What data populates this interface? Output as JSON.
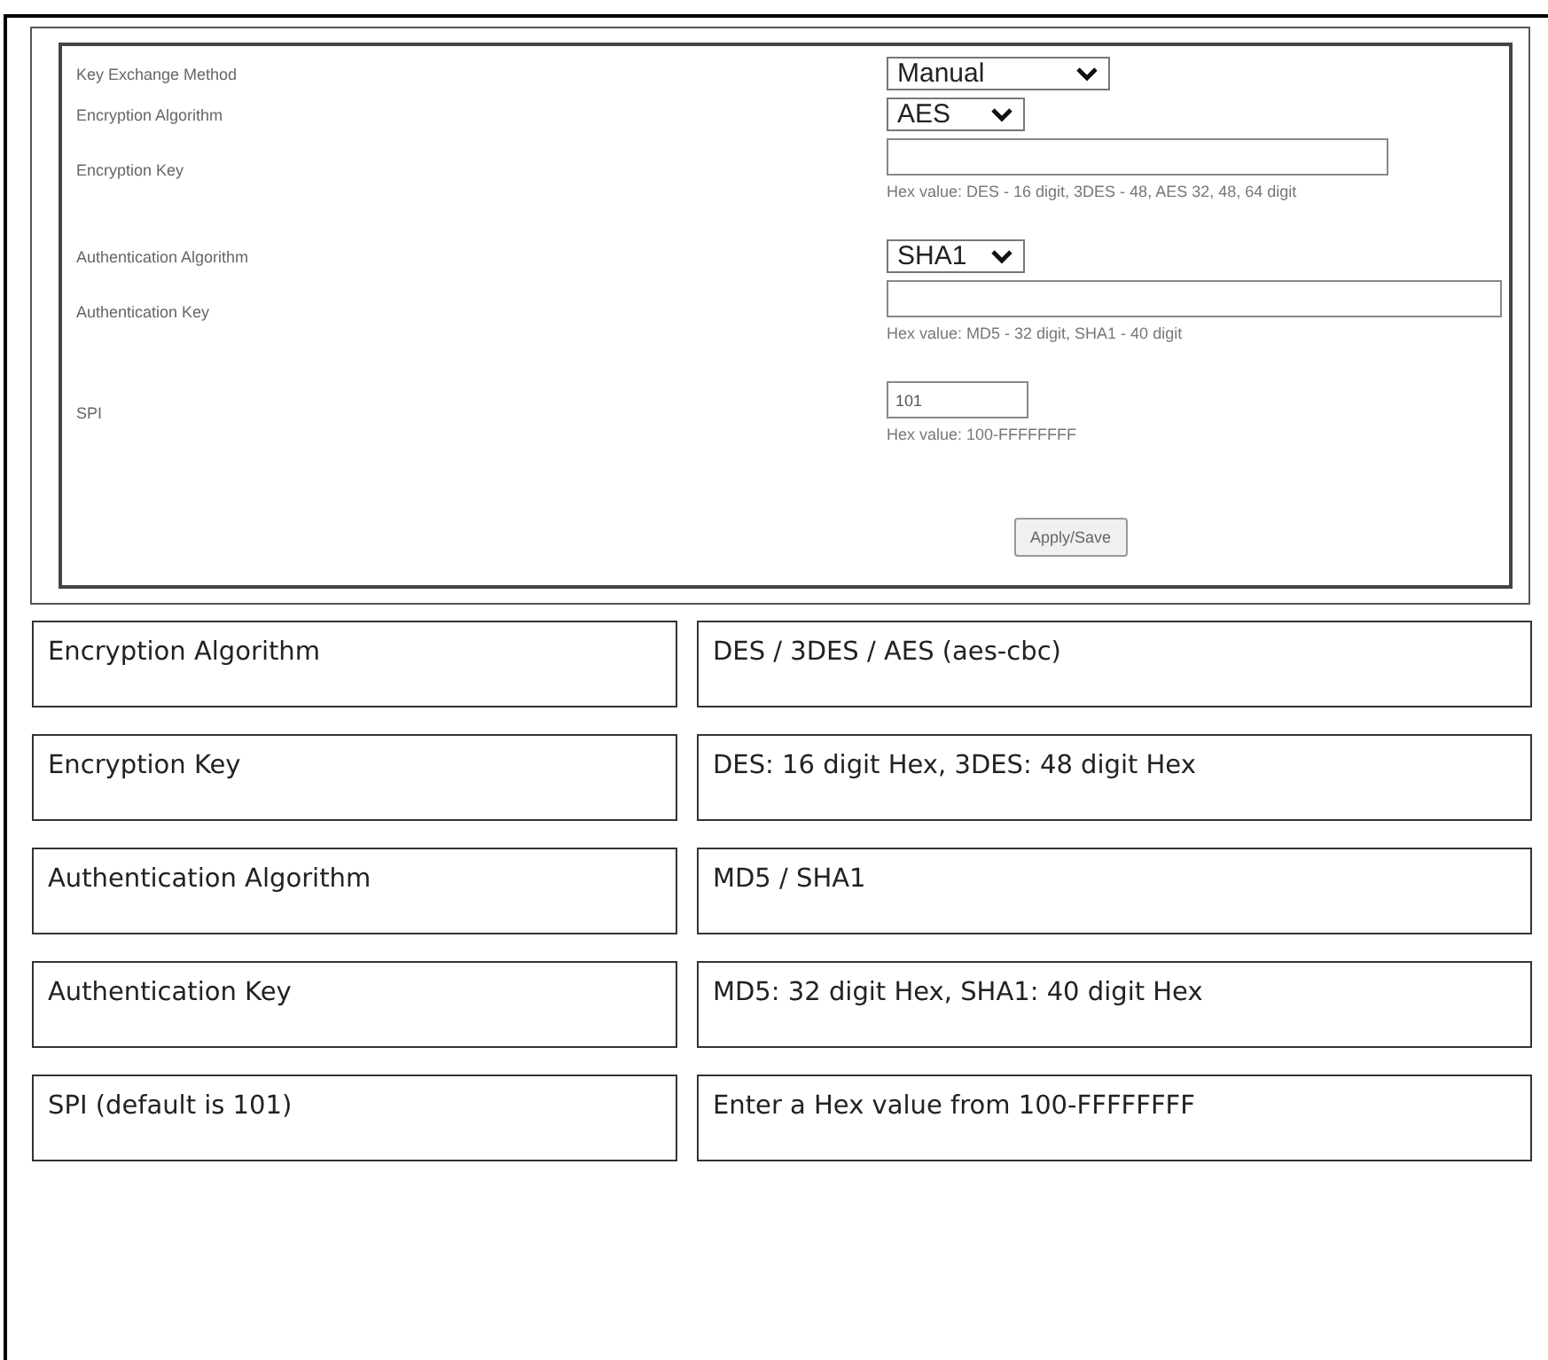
{
  "form": {
    "fields": [
      {
        "label": "Key Exchange Method",
        "kind": "select",
        "value": "Manual"
      },
      {
        "label": "Encryption Algorithm",
        "kind": "select",
        "value": "AES"
      },
      {
        "label": "Encryption Key",
        "kind": "input",
        "hint": "Hex value: DES - 16 digit, 3DES - 48, AES 32, 48, 64 digit"
      },
      {
        "label": "Authentication Algorithm",
        "kind": "select",
        "value": "SHA1"
      },
      {
        "label": "Authentication Key",
        "kind": "input",
        "hint": "Hex value: MD5 - 32 digit, SHA1 - 40 digit"
      },
      {
        "label": "SPI",
        "kind": "input",
        "value": "101",
        "hint": "Hex value: 100-FFFFFFFF"
      }
    ],
    "button": "Apply/Save"
  },
  "table": {
    "rows": [
      [
        "Encryption Algorithm",
        "DES / 3DES / AES (aes-cbc)"
      ],
      [
        "Encryption Key",
        "DES: 16 digit Hex, 3DES: 48 digit Hex"
      ],
      [
        "Authentication Algorithm",
        "MD5 / SHA1"
      ],
      [
        "Authentication Key",
        "MD5: 32 digit Hex, SHA1: 40 digit Hex"
      ],
      [
        "SPI (default is 101)",
        "Enter a Hex value from 100-FFFFFFFF"
      ]
    ]
  }
}
